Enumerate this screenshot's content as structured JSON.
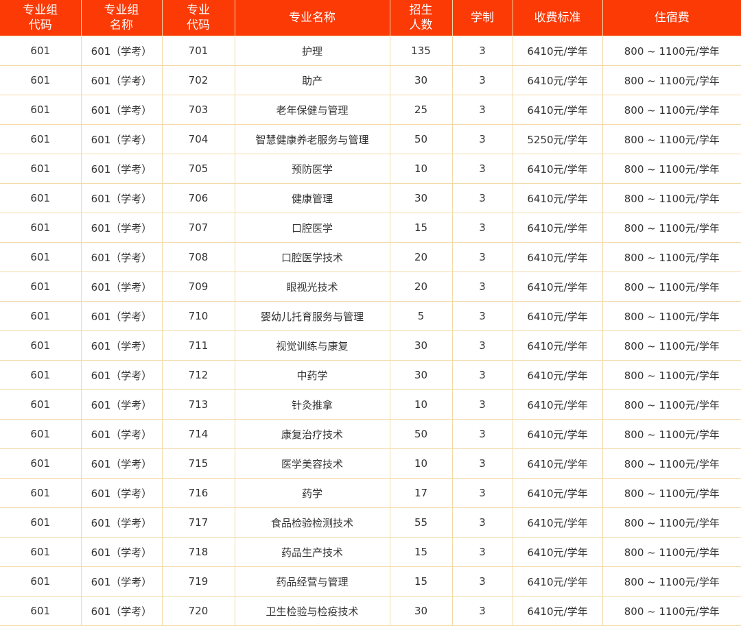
{
  "table": {
    "headers": [
      "专业组\n代码",
      "专业组\n名称",
      "专业\n代码",
      "专业名称",
      "招生\n人数",
      "学制",
      "收费标准",
      "住宿费"
    ],
    "rows": [
      [
        "601",
        "601（学考）",
        "701",
        "护理",
        "135",
        "3",
        "6410元/学年",
        "800 ~ 1100元/学年"
      ],
      [
        "601",
        "601（学考）",
        "702",
        "助产",
        "30",
        "3",
        "6410元/学年",
        "800 ~ 1100元/学年"
      ],
      [
        "601",
        "601（学考）",
        "703",
        "老年保健与管理",
        "25",
        "3",
        "6410元/学年",
        "800 ~ 1100元/学年"
      ],
      [
        "601",
        "601（学考）",
        "704",
        "智慧健康养老服务与管理",
        "50",
        "3",
        "5250元/学年",
        "800 ~ 1100元/学年"
      ],
      [
        "601",
        "601（学考）",
        "705",
        "预防医学",
        "10",
        "3",
        "6410元/学年",
        "800 ~ 1100元/学年"
      ],
      [
        "601",
        "601（学考）",
        "706",
        "健康管理",
        "30",
        "3",
        "6410元/学年",
        "800 ~ 1100元/学年"
      ],
      [
        "601",
        "601（学考）",
        "707",
        "口腔医学",
        "15",
        "3",
        "6410元/学年",
        "800 ~ 1100元/学年"
      ],
      [
        "601",
        "601（学考）",
        "708",
        "口腔医学技术",
        "20",
        "3",
        "6410元/学年",
        "800 ~ 1100元/学年"
      ],
      [
        "601",
        "601（学考）",
        "709",
        "眼视光技术",
        "20",
        "3",
        "6410元/学年",
        "800 ~ 1100元/学年"
      ],
      [
        "601",
        "601（学考）",
        "710",
        "婴幼儿托育服务与管理",
        "5",
        "3",
        "6410元/学年",
        "800 ~ 1100元/学年"
      ],
      [
        "601",
        "601（学考）",
        "711",
        "视觉训练与康复",
        "30",
        "3",
        "6410元/学年",
        "800 ~ 1100元/学年"
      ],
      [
        "601",
        "601（学考）",
        "712",
        "中药学",
        "30",
        "3",
        "6410元/学年",
        "800 ~ 1100元/学年"
      ],
      [
        "601",
        "601（学考）",
        "713",
        "针灸推拿",
        "10",
        "3",
        "6410元/学年",
        "800 ~ 1100元/学年"
      ],
      [
        "601",
        "601（学考）",
        "714",
        "康复治疗技术",
        "50",
        "3",
        "6410元/学年",
        "800 ~ 1100元/学年"
      ],
      [
        "601",
        "601（学考）",
        "715",
        "医学美容技术",
        "10",
        "3",
        "6410元/学年",
        "800 ~ 1100元/学年"
      ],
      [
        "601",
        "601（学考）",
        "716",
        "药学",
        "17",
        "3",
        "6410元/学年",
        "800 ~ 1100元/学年"
      ],
      [
        "601",
        "601（学考）",
        "717",
        "食品检验检测技术",
        "55",
        "3",
        "6410元/学年",
        "800 ~ 1100元/学年"
      ],
      [
        "601",
        "601（学考）",
        "718",
        "药品生产技术",
        "15",
        "3",
        "6410元/学年",
        "800 ~ 1100元/学年"
      ],
      [
        "601",
        "601（学考）",
        "719",
        "药品经营与管理",
        "15",
        "3",
        "6410元/学年",
        "800 ~ 1100元/学年"
      ],
      [
        "601",
        "601（学考）",
        "720",
        "卫生检验与检疫技术",
        "30",
        "3",
        "6410元/学年",
        "800 ~ 1100元/学年"
      ]
    ]
  },
  "colors": {
    "header_background": "#fb3a06",
    "header_text": "#ffffff",
    "grid_line": "#f3d9a6",
    "cell_text": "#333333"
  }
}
